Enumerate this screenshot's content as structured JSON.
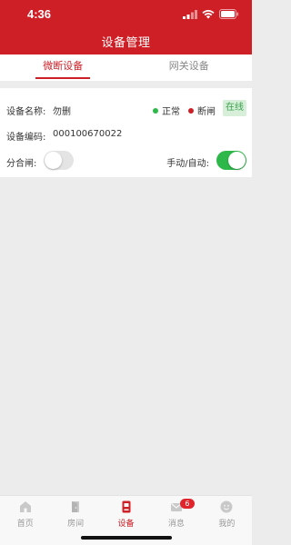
{
  "status_bar": {
    "time": "4:36"
  },
  "header": {
    "title": "设备管理"
  },
  "tabs": [
    {
      "label": "微断设备",
      "active": true
    },
    {
      "label": "网关设备",
      "active": false
    }
  ],
  "device": {
    "name_label": "设备名称:",
    "name_value": "勿删",
    "code_label": "设备编码:",
    "code_value": "000100670022",
    "legend": [
      {
        "label": "正常",
        "color": "#2fb84a"
      },
      {
        "label": "断闸",
        "color": "#cf1f26"
      }
    ],
    "online_status": "在线",
    "switch_label": "分合闸:",
    "switch_state": "off",
    "mode_label": "手动/自动:",
    "mode_state": "on"
  },
  "tabbar": {
    "items": [
      {
        "label": "首页",
        "icon": "home-icon",
        "active": false
      },
      {
        "label": "房间",
        "icon": "door-icon",
        "active": false
      },
      {
        "label": "设备",
        "icon": "device-icon",
        "active": true
      },
      {
        "label": "消息",
        "icon": "mail-icon",
        "active": false,
        "badge": "6"
      },
      {
        "label": "我的",
        "icon": "profile-icon",
        "active": false
      }
    ]
  },
  "colors": {
    "brand": "#cf1f26",
    "success": "#2fb84a"
  }
}
